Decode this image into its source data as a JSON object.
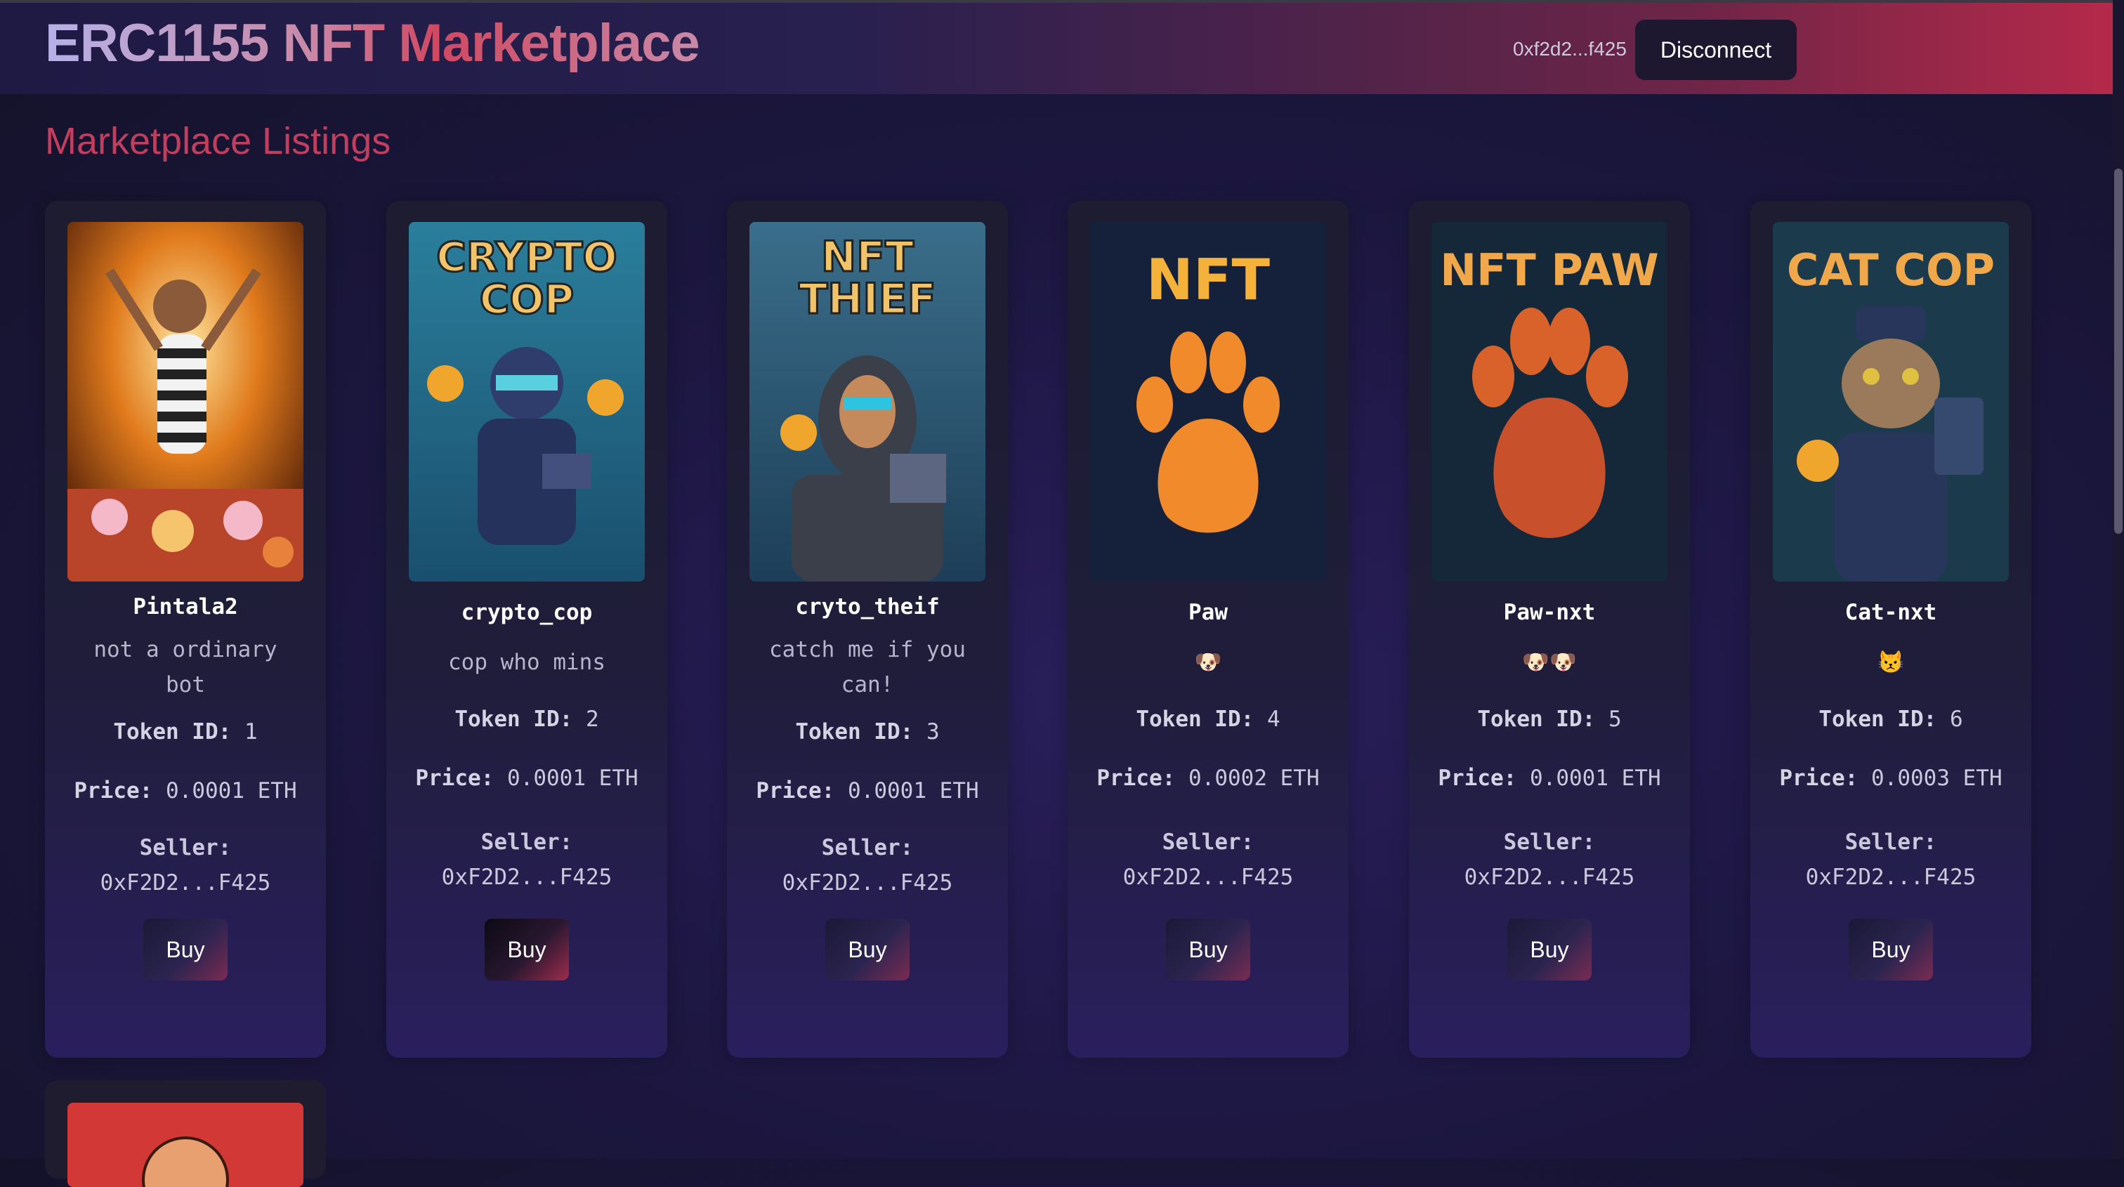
{
  "header": {
    "title": "ERC1155 NFT Marketplace",
    "address": "0xf2d2...f425",
    "disconnect_label": "Disconnect"
  },
  "main": {
    "section_title": "Marketplace Listings",
    "token_id_label": "Token ID:",
    "price_label": "Price:",
    "seller_label": "Seller:",
    "buy_label": "Buy"
  },
  "listings": [
    {
      "name": "Pintala2",
      "description": "not a ordinary bot",
      "token_id": "1",
      "price": "0.0001 ETH",
      "seller": "0xF2D2...F425",
      "image": "striped-monkey-image"
    },
    {
      "name": "crypto_cop",
      "description": "cop who mins",
      "token_id": "2",
      "price": "0.0001 ETH",
      "seller": "0xF2D2...F425",
      "image": "crypto-cop-image",
      "image_text": "CRYPTO COP"
    },
    {
      "name": "cryto_theif",
      "description": "catch me if you can!",
      "token_id": "3",
      "price": "0.0001 ETH",
      "seller": "0xF2D2...F425",
      "image": "nft-thief-image",
      "image_text": "NFT THIEF"
    },
    {
      "name": "Paw",
      "description": "🐶",
      "token_id": "4",
      "price": "0.0002 ETH",
      "seller": "0xF2D2...F425",
      "image": "nft-paw-image",
      "image_text": "NFT"
    },
    {
      "name": "Paw-nxt",
      "description": "🐶🐶",
      "token_id": "5",
      "price": "0.0001 ETH",
      "seller": "0xF2D2...F425",
      "image": "nft-paw-red-image",
      "image_text": "NFT PAW"
    },
    {
      "name": "Cat-nxt",
      "description": "😾",
      "token_id": "6",
      "price": "0.0003 ETH",
      "seller": "0xF2D2...F425",
      "image": "cat-cop-image",
      "image_text": "CAT COP"
    }
  ]
}
